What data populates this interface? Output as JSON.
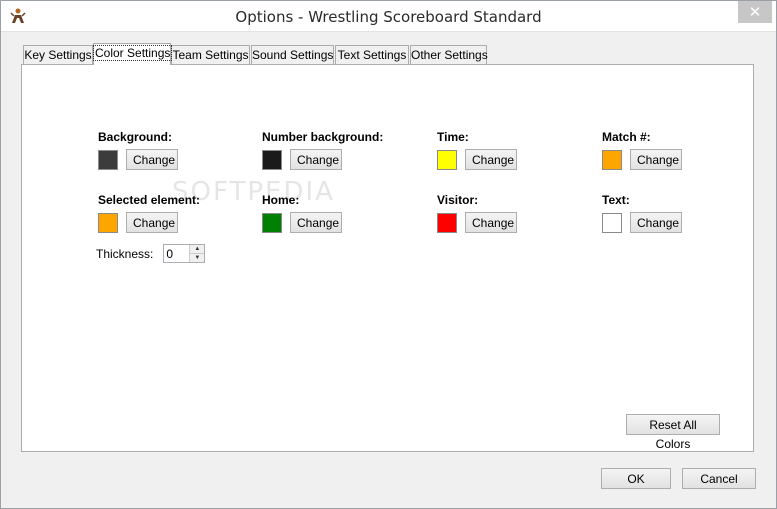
{
  "window": {
    "title": "Options - Wrestling Scoreboard Standard",
    "close_glyph": "✕"
  },
  "tabs": [
    {
      "label": "Key Settings",
      "active": false
    },
    {
      "label": "Color Settings",
      "active": true
    },
    {
      "label": "Team Settings",
      "active": false
    },
    {
      "label": "Sound Settings",
      "active": false
    },
    {
      "label": "Text Settings",
      "active": false
    },
    {
      "label": "Other Settings",
      "active": false
    }
  ],
  "colors": {
    "background": {
      "label": "Background:",
      "swatch": "#3c3c3c"
    },
    "number_background": {
      "label": "Number background:",
      "swatch": "#1a1a1a"
    },
    "time": {
      "label": "Time:",
      "swatch": "#ffff00"
    },
    "match": {
      "label": "Match #:",
      "swatch": "#ffa500"
    },
    "selected_element": {
      "label": "Selected element:",
      "swatch": "#ffa500"
    },
    "home": {
      "label": "Home:",
      "swatch": "#008000"
    },
    "visitor": {
      "label": "Visitor:",
      "swatch": "#ff0000"
    },
    "text": {
      "label": "Text:",
      "swatch": "#ffffff"
    },
    "change_label": "Change"
  },
  "thickness": {
    "label": "Thickness:",
    "value": "0"
  },
  "buttons": {
    "reset_all": "Reset All Colors",
    "ok": "OK",
    "cancel": "Cancel"
  },
  "watermark": "SOFTPEDIA"
}
